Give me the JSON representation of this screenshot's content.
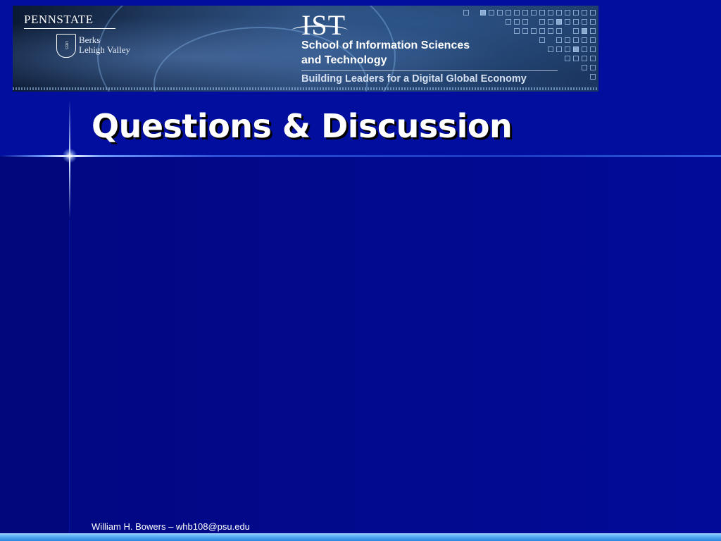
{
  "banner": {
    "pennstate_logo": "PENNSTATE",
    "shield_year": "1855",
    "campus_line1": "Berks",
    "campus_line2": "Lehigh Valley",
    "ist_logo": "IST",
    "ist_subtitle_line1": "School of Information Sciences",
    "ist_subtitle_line2": "and Technology",
    "ist_tagline": "Building Leaders for a Digital Global Economy"
  },
  "slide": {
    "title": "Questions & Discussion",
    "footer": "William H. Bowers – whb108@psu.edu"
  },
  "colors": {
    "background": "#020f9e",
    "title_text": "#ffffff",
    "footer_bar": "#5ab0f5"
  }
}
